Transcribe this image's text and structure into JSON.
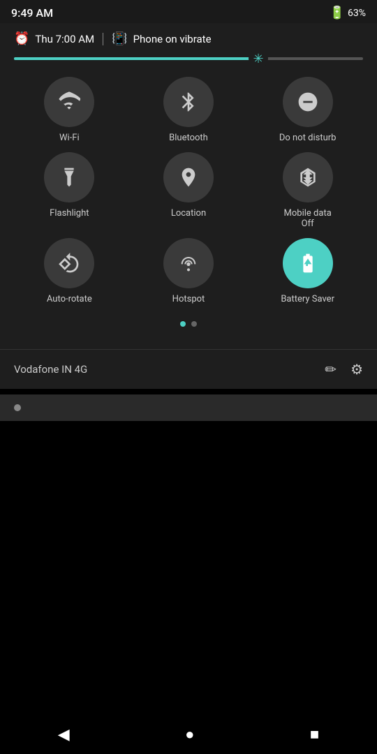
{
  "statusBar": {
    "time": "9:49 AM",
    "battery": "63%",
    "batteryIcon": "🔋"
  },
  "infoRow": {
    "alarmIcon": "⏰",
    "alarmText": "Thu 7:00 AM",
    "vibrateIcon": "📳",
    "vibrateText": "Phone on vibrate"
  },
  "brightness": {
    "fillPercent": 70
  },
  "tiles": [
    {
      "id": "wifi",
      "label": "Wi-Fi",
      "active": false
    },
    {
      "id": "bluetooth",
      "label": "Bluetooth",
      "active": false
    },
    {
      "id": "dnd",
      "label": "Do not disturb",
      "active": false
    },
    {
      "id": "flashlight",
      "label": "Flashlight",
      "active": false
    },
    {
      "id": "location",
      "label": "Location",
      "active": false
    },
    {
      "id": "mobiledata",
      "label": "Mobile data\nOff",
      "labelLine1": "Mobile data",
      "labelLine2": "Off",
      "active": false
    },
    {
      "id": "autorotate",
      "label": "Auto-rotate",
      "active": false
    },
    {
      "id": "hotspot",
      "label": "Hotspot",
      "active": false
    },
    {
      "id": "batterysaver",
      "label": "Battery Saver",
      "active": true
    }
  ],
  "pageDots": [
    {
      "active": true
    },
    {
      "active": false
    }
  ],
  "footer": {
    "carrier": "Vodafone IN 4G",
    "editLabel": "✏",
    "settingsLabel": "⚙"
  },
  "navBar": {
    "back": "◀",
    "home": "●",
    "recents": "■"
  }
}
